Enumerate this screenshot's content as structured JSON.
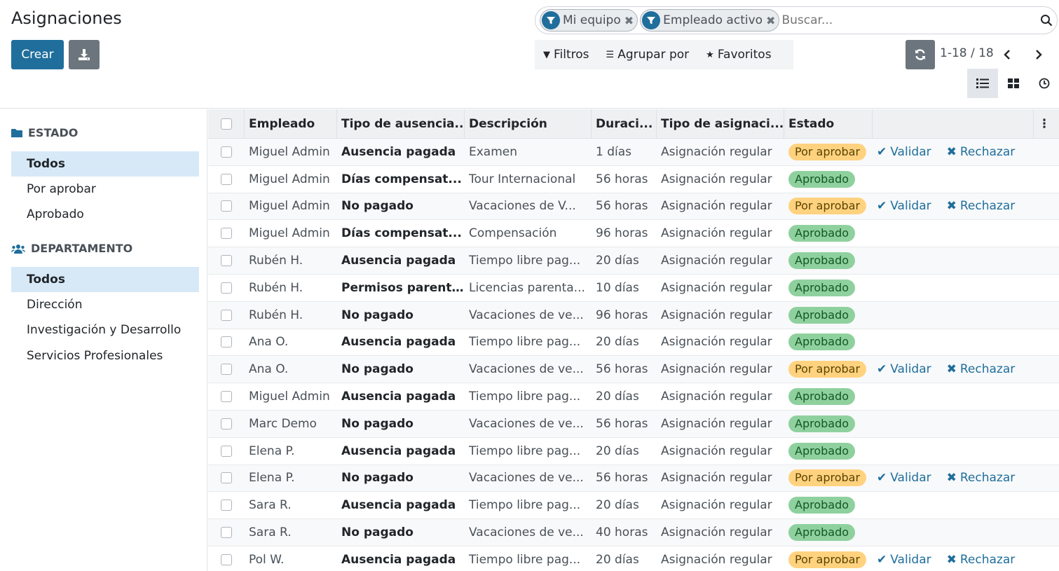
{
  "header": {
    "title": "Asignaciones",
    "create_label": "Crear"
  },
  "search": {
    "facets": [
      {
        "label": "Mi equipo"
      },
      {
        "label": "Empleado activo"
      }
    ],
    "placeholder": "Buscar..."
  },
  "filters": {
    "filters_label": "Filtros",
    "groupby_label": "Agrupar por",
    "favorites_label": "Favoritos"
  },
  "pager": {
    "text": "1-18 / 18"
  },
  "sidebar": {
    "sections": [
      {
        "title": "ESTADO",
        "items": [
          "Todos",
          "Por aprobar",
          "Aprobado"
        ],
        "active": 0
      },
      {
        "title": "DEPARTAMENTO",
        "items": [
          "Todos",
          "Dirección",
          "Investigación y Desarrollo",
          "Servicios Profesionales"
        ],
        "active": 0
      }
    ]
  },
  "table": {
    "columns": [
      "Empleado",
      "Tipo de ausencia...",
      "Descripción",
      "Duraci...",
      "Tipo de asignaci...",
      "Estado"
    ],
    "action_validate": "Validar",
    "action_reject": "Rechazar",
    "rows": [
      {
        "employee": "Miguel Admin",
        "type": "Ausencia pagada",
        "description": "Examen",
        "duration": "1 días",
        "alloc_type": "Asignación regular",
        "state": "Por aprobar",
        "pending": true
      },
      {
        "employee": "Miguel Admin",
        "type": "Días compensat...",
        "description": "Tour Internacional",
        "duration": "56 horas",
        "alloc_type": "Asignación regular",
        "state": "Aprobado",
        "pending": false
      },
      {
        "employee": "Miguel Admin",
        "type": "No pagado",
        "description": "Vacaciones de V...",
        "duration": "56 horas",
        "alloc_type": "Asignación regular",
        "state": "Por aprobar",
        "pending": true
      },
      {
        "employee": "Miguel Admin",
        "type": "Días compensat...",
        "description": "Compensación",
        "duration": "96 horas",
        "alloc_type": "Asignación regular",
        "state": "Aprobado",
        "pending": false
      },
      {
        "employee": "Rubén H.",
        "type": "Ausencia pagada",
        "description": "Tiempo libre pag...",
        "duration": "20 días",
        "alloc_type": "Asignación regular",
        "state": "Aprobado",
        "pending": false
      },
      {
        "employee": "Rubén H.",
        "type": "Permisos parent...",
        "description": "Licencias parenta...",
        "duration": "10 días",
        "alloc_type": "Asignación regular",
        "state": "Aprobado",
        "pending": false
      },
      {
        "employee": "Rubén H.",
        "type": "No pagado",
        "description": "Vacaciones de ve...",
        "duration": "96 horas",
        "alloc_type": "Asignación regular",
        "state": "Aprobado",
        "pending": false
      },
      {
        "employee": "Ana O.",
        "type": "Ausencia pagada",
        "description": "Tiempo libre pag...",
        "duration": "20 días",
        "alloc_type": "Asignación regular",
        "state": "Aprobado",
        "pending": false
      },
      {
        "employee": "Ana O.",
        "type": "No pagado",
        "description": "Vacaciones de ve...",
        "duration": "56 horas",
        "alloc_type": "Asignación regular",
        "state": "Por aprobar",
        "pending": true
      },
      {
        "employee": "Miguel Admin",
        "type": "Ausencia pagada",
        "description": "Tiempo libre pag...",
        "duration": "20 días",
        "alloc_type": "Asignación regular",
        "state": "Aprobado",
        "pending": false
      },
      {
        "employee": "Marc Demo",
        "type": "No pagado",
        "description": "Vacaciones de ve...",
        "duration": "56 horas",
        "alloc_type": "Asignación regular",
        "state": "Aprobado",
        "pending": false
      },
      {
        "employee": "Elena P.",
        "type": "Ausencia pagada",
        "description": "Tiempo libre pag...",
        "duration": "20 días",
        "alloc_type": "Asignación regular",
        "state": "Aprobado",
        "pending": false
      },
      {
        "employee": "Elena P.",
        "type": "No pagado",
        "description": "Vacaciones de ve...",
        "duration": "56 horas",
        "alloc_type": "Asignación regular",
        "state": "Por aprobar",
        "pending": true
      },
      {
        "employee": "Sara R.",
        "type": "Ausencia pagada",
        "description": "Tiempo libre pag...",
        "duration": "20 días",
        "alloc_type": "Asignación regular",
        "state": "Aprobado",
        "pending": false
      },
      {
        "employee": "Sara R.",
        "type": "No pagado",
        "description": "Vacaciones de ve...",
        "duration": "40 horas",
        "alloc_type": "Asignación regular",
        "state": "Aprobado",
        "pending": false
      },
      {
        "employee": "Pol W.",
        "type": "Ausencia pagada",
        "description": "Tiempo libre pag...",
        "duration": "20 días",
        "alloc_type": "Asignación regular",
        "state": "Por aprobar",
        "pending": true
      }
    ]
  },
  "colors": {
    "primary": "#1f6e9c",
    "secondary": "#6c757d",
    "approved": "#8fd19e",
    "pending": "#ffd27f",
    "sidebar_active": "#d7e9f7"
  }
}
